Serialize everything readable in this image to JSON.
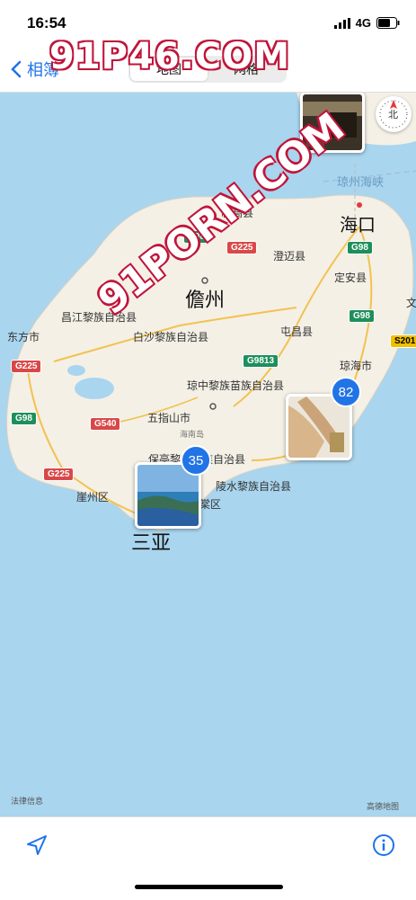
{
  "status": {
    "time": "16:54",
    "network": "4G"
  },
  "nav": {
    "back_label": "相簿",
    "segments": [
      "地图",
      "网格"
    ],
    "active_segment": 0
  },
  "watermark": {
    "main": "91P46.COM",
    "diagonal": "91PORN.COM"
  },
  "map": {
    "labels": {
      "strait": "琼州海峡",
      "haikou": "海口",
      "lingao": "临高县",
      "chengmai": "澄迈县",
      "dingan": "定安县",
      "danzhou": "儋州",
      "wen": "文",
      "changjiang": "昌江黎族自治县",
      "dongfang": "东方市",
      "baisha": "白沙黎族自治县",
      "tunchang": "屯昌县",
      "qionghai": "琼海市",
      "qiongzhong": "琼中黎族苗族自治县",
      "wuzhishan": "五指山市",
      "hainandao": "海南岛",
      "baoting": "保亭黎族苗族自治县",
      "lingshui": "陵水黎族自治县",
      "yazhou": "崖州区",
      "haitang": "棠区",
      "sanya": "三亚",
      "legal": "法律信息",
      "provider": "高德地图"
    },
    "roads": [
      "G98",
      "G225",
      "G98",
      "G98",
      "S201",
      "G225",
      "G9813",
      "G98",
      "G540",
      "G225"
    ],
    "clusters": [
      {
        "count": "82"
      },
      {
        "count": "35"
      }
    ],
    "compass_label": "北"
  },
  "colors": {
    "accent": "#1f73e8",
    "land": "#f4f0e6",
    "sea": "#a9d5ee",
    "badge": "#2174e6"
  }
}
